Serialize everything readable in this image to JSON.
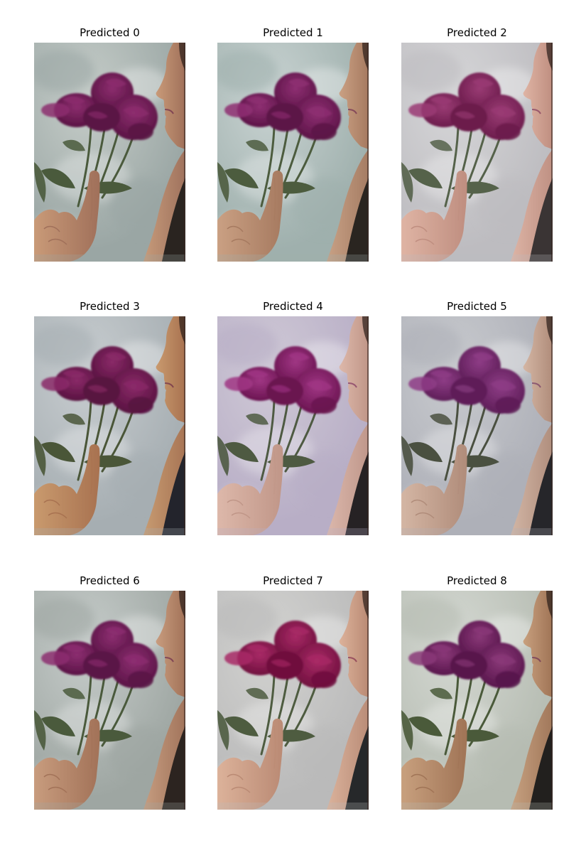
{
  "panels": [
    {
      "title": "Predicted 0",
      "tone": {
        "bg": "#c6cdc9",
        "bg2": "#9aa6a4",
        "petal": "#5a1444",
        "petal2": "#8c2d6e",
        "skin": "#c99a78",
        "skin2": "#a0705a",
        "leaf": "#4a5a3c",
        "dress": "#2a2420"
      }
    },
    {
      "title": "Predicted 1",
      "tone": {
        "bg": "#c9d3d2",
        "bg2": "#9fb0ad",
        "petal": "#5c1447",
        "petal2": "#8e2f72",
        "skin": "#caa083",
        "skin2": "#a67a60",
        "leaf": "#4c5c3e",
        "dress": "#2a2520"
      }
    },
    {
      "title": "Predicted 2",
      "tone": {
        "bg": "#d6d6d8",
        "bg2": "#bdbcc0",
        "petal": "#6c1c4c",
        "petal2": "#9a3b74",
        "skin": "#dfb4a4",
        "skin2": "#bf8e80",
        "leaf": "#55624a",
        "dress": "#3a3434"
      }
    },
    {
      "title": "Predicted 3",
      "tone": {
        "bg": "#c8cdd0",
        "bg2": "#a6aeb2",
        "petal": "#581240",
        "petal2": "#8a2a68",
        "skin": "#c99a6e",
        "skin2": "#a87250",
        "leaf": "#4a5638",
        "dress": "#23242c"
      }
    },
    {
      "title": "Predicted 4",
      "tone": {
        "bg": "#cfc9d6",
        "bg2": "#b8aec6",
        "petal": "#6a1450",
        "petal2": "#a03684",
        "skin": "#ddb8aa",
        "skin2": "#c09688",
        "leaf": "#4e5a42",
        "dress": "#262224"
      }
    },
    {
      "title": "Predicted 5",
      "tone": {
        "bg": "#c8cace",
        "bg2": "#aeb0b8",
        "petal": "#5e1e58",
        "petal2": "#8e3c86",
        "skin": "#d4b6a4",
        "skin2": "#b08c7a",
        "leaf": "#4a5040",
        "dress": "#26262a"
      }
    },
    {
      "title": "Predicted 6",
      "tone": {
        "bg": "#c6ccca",
        "bg2": "#9ea6a2",
        "petal": "#5a1446",
        "petal2": "#8c2e70",
        "skin": "#c89c7e",
        "skin2": "#a27258",
        "leaf": "#4a5a3c",
        "dress": "#2c2420"
      }
    },
    {
      "title": "Predicted 7",
      "tone": {
        "bg": "#d2d2d0",
        "bg2": "#bababa",
        "petal": "#70103e",
        "petal2": "#a82a66",
        "skin": "#dcb29a",
        "skin2": "#ba8a74",
        "leaf": "#4e5c40",
        "dress": "#26282a"
      }
    },
    {
      "title": "Predicted 8",
      "tone": {
        "bg": "#d4d8d2",
        "bg2": "#b6bcb2",
        "petal": "#58164c",
        "petal2": "#8a3878",
        "skin": "#c8a07e",
        "skin2": "#a07456",
        "leaf": "#4a5a3a",
        "dress": "#22201e"
      }
    }
  ]
}
